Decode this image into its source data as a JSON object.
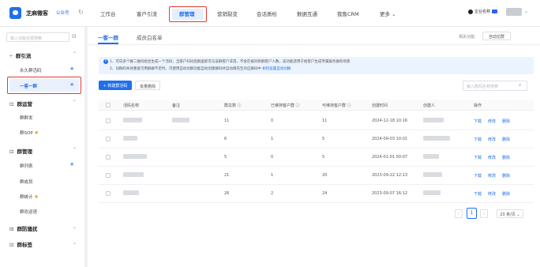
{
  "brand": {
    "name": "芝麻微客",
    "badge": "公众号"
  },
  "topnav": {
    "items": [
      "工作台",
      "客户引流",
      "群管理",
      "营销裂变",
      "会话质检",
      "数据互通",
      "我售CRM",
      "更多 ⌄"
    ],
    "active_index": 2
  },
  "user": {
    "name": "企业名称"
  },
  "sidebar": {
    "search_placeholder": "输入功能名称搜索",
    "groups": [
      {
        "label": "群引流",
        "items": [
          "永久群活码",
          "一客一群"
        ]
      },
      {
        "label": "群运营",
        "items": [
          "群群发",
          "群SOP"
        ]
      },
      {
        "label": "群管理",
        "items": [
          "群列表",
          "群成员",
          "群统计",
          "群欢迎语"
        ]
      },
      {
        "label": "群防骚扰",
        "items": []
      },
      {
        "label": "群标签",
        "items": []
      }
    ],
    "active_item": "一客一群"
  },
  "main": {
    "tabs": [
      "一客一群",
      "成员白名单"
    ],
    "active_tab": 0,
    "related_label": "相关功能:",
    "related_button": "自动拉群",
    "notice": {
      "line1": "1、可向多个群二维码组合生成一个活码，当客户扫码后群里即可与该群客户非常，不会在被对新群客户人数，该功能适用于给客户生成专属服务群的场景",
      "line2": "2、创群码失效重复可用群群不足时，可使用自动创群功能自动创建群码并自动填充至对应群码中",
      "link": "如何设置自动创群"
    },
    "new_button": "+ 新建群活码",
    "batch_delete": "批量删除",
    "table_search_placeholder": "输入群码名称搜索",
    "columns": [
      "活码名称",
      "备注",
      "群总数 ⓘ",
      "已维持客户群 ⓘ",
      "可维持客户群 ⓘ",
      "创建时间",
      "创建人",
      "操作"
    ],
    "rows": [
      {
        "total": "11",
        "maintained": "0",
        "available": "11",
        "created": "2024-12-18 10:16"
      },
      {
        "total": "6",
        "maintained": "1",
        "available": "5",
        "created": "2024-09-03 10:01"
      },
      {
        "total": "5",
        "maintained": "0",
        "available": "5",
        "created": "2024-01-01 00:07"
      },
      {
        "total": "21",
        "maintained": "1",
        "available": "20",
        "created": "2023-09-22 12:13"
      },
      {
        "total": "26",
        "maintained": "2",
        "available": "24",
        "created": "2023-09-07 16:12"
      }
    ],
    "row_actions": [
      "下载",
      "修改",
      "删除"
    ],
    "pagination": {
      "prev": "‹",
      "current": "1",
      "next": "›",
      "page_size": "20 条/页 ⌄"
    }
  }
}
